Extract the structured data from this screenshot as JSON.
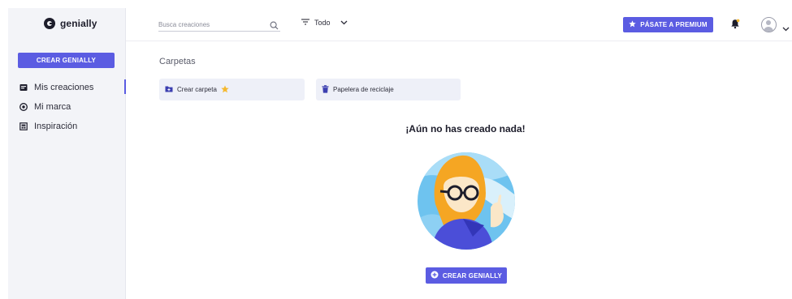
{
  "brand": {
    "name": "genially"
  },
  "sidebar": {
    "create_button": "CREAR GENIALLY",
    "items": [
      {
        "label": "Mis creaciones",
        "icon": "presentation-icon",
        "active": true
      },
      {
        "label": "Mi marca",
        "icon": "brand-icon",
        "active": false
      },
      {
        "label": "Inspiración",
        "icon": "inspiration-icon",
        "active": false
      }
    ]
  },
  "header": {
    "search_placeholder": "Busca creaciones",
    "filter_label": "Todo",
    "premium_button": "PÁSATE A PREMIUM"
  },
  "main": {
    "section_title": "Carpetas",
    "folder_card": "Crear carpeta",
    "trash_card": "Papelera de reciclaje",
    "empty_title": "¡Aún no has creado nada!",
    "create_button": "CREAR GENIALLY"
  },
  "colors": {
    "accent": "#5b5ce2",
    "sidebar_bg": "#f3f4f8",
    "card_bg": "#eef0f8",
    "star": "#f5b82e"
  }
}
